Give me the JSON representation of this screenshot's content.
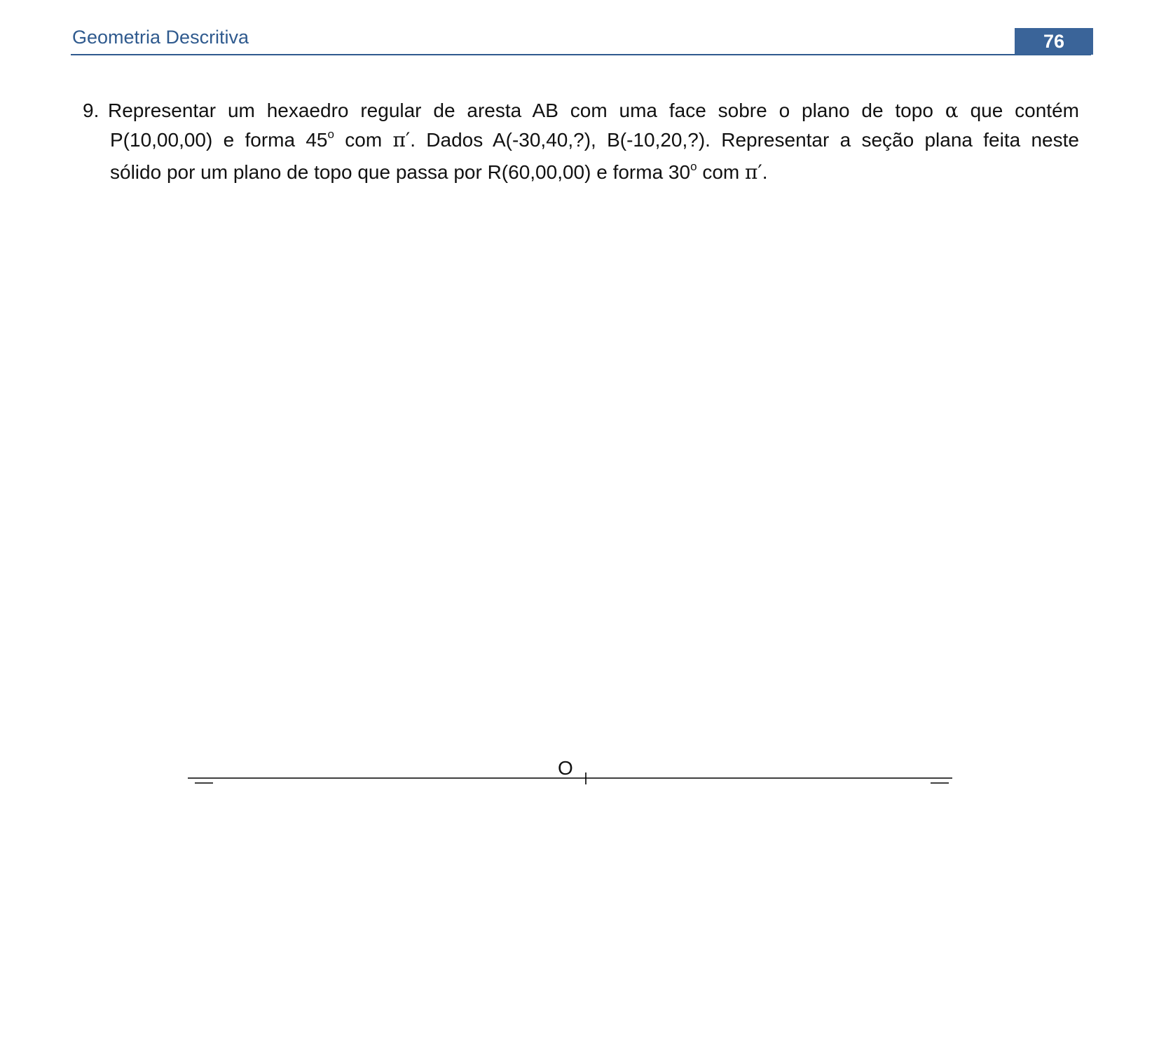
{
  "header": {
    "title": "Geometria Descritiva",
    "page_number": "76"
  },
  "problem": {
    "number": "9.",
    "line1_a": "Representar um hexaedro regular de aresta AB com uma face sobre o plano de topo ",
    "alpha": "α",
    "line1_b": " que contém",
    "line2_a": "P(10,00,00) e forma 45",
    "degree1": "o",
    "line2_b": " com ",
    "pi1": "π′",
    "line2_c": ". Dados A(-30,40,?), B(-10,20,?). Representar a seção plana feita neste",
    "line3_a": "sólido por um plano de topo que passa por R(60,00,00) e forma 30",
    "degree2": "o",
    "line3_b": " com ",
    "pi2": "π′",
    "line3_c": "."
  },
  "diagram": {
    "origin_label": "O"
  }
}
